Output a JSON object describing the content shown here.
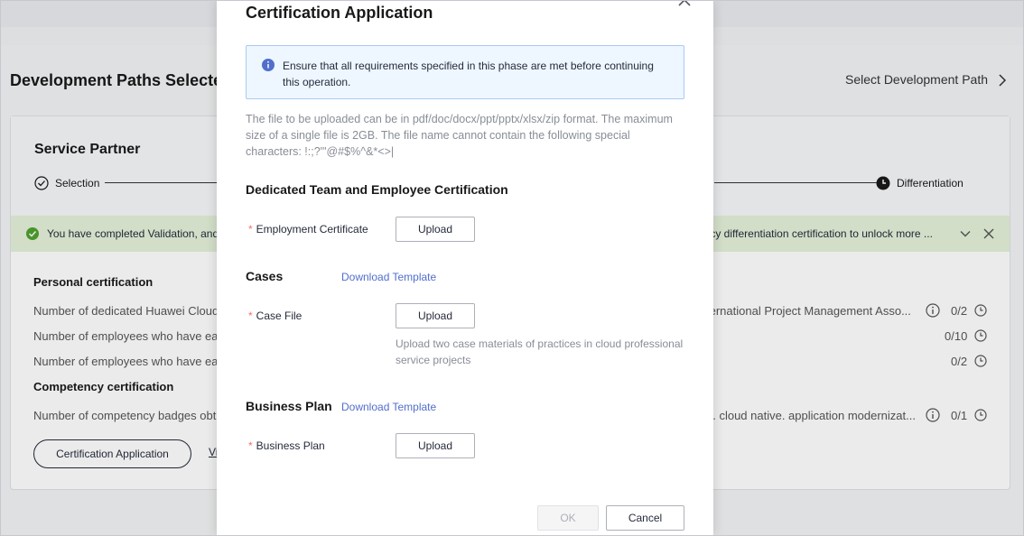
{
  "background": {
    "page_title": "Development Paths Selected",
    "select_path_link": "Select Development Path",
    "partner_title": "Service Partner",
    "steps": {
      "first": "Selection",
      "last": "Differentiation"
    },
    "success_banner": {
      "text_left": "You have completed Validation, and",
      "text_right": "ency differentiation certification to unlock more ..."
    },
    "personal_cert": {
      "title": "Personal certification",
      "rows": [
        {
          "text": "Number of dedicated Huawei Cloud",
          "right_text": "ternational Project Management Asso...",
          "count": "0/2"
        },
        {
          "text": "Number of employees who have ea",
          "right_text": "",
          "count": "0/10"
        },
        {
          "text": "Number of employees who have ea",
          "right_text": "",
          "count": "0/2"
        }
      ]
    },
    "competency_cert": {
      "title": "Competency certification",
      "rows": [
        {
          "text": "Number of competency badges obt",
          "right_text": "n. cloud native. application modernizat...",
          "count": "0/1"
        }
      ]
    },
    "cert_button": "Certification Application",
    "view_link": "Vi"
  },
  "modal": {
    "title": "Certification Application",
    "notice": "Ensure that all requirements specified in this phase are met before continuing this operation.",
    "file_note": "The file to be uploaded can be in pdf/doc/docx/ppt/pptx/xlsx/zip format. The maximum size of a single file is 2GB. The file name cannot contain the following special characters: !:;?'\"@#$%^&*<>|",
    "sections": {
      "team": {
        "title": "Dedicated Team and Employee Certification",
        "field_label": "Employment Certificate",
        "upload_label": "Upload"
      },
      "cases": {
        "title": "Cases",
        "download_label": "Download Template",
        "field_label": "Case File",
        "upload_label": "Upload",
        "hint": "Upload two case materials of practices in cloud professional service projects"
      },
      "plan": {
        "title": "Business Plan",
        "download_label": "Download Template",
        "field_label": "Business Plan",
        "upload_label": "Upload"
      }
    },
    "required_mark": "*",
    "ok_label": "OK",
    "cancel_label": "Cancel"
  },
  "colors": {
    "accent_link": "#526ecc",
    "success_bg": "#e4f1d9",
    "success_icon": "#50a12e",
    "notice_bg": "#eef6ff",
    "info_icon": "#526ecc",
    "required": "#f66f6a"
  },
  "icons": {
    "close": "close-icon",
    "info": "info-icon",
    "success": "check-circle-icon",
    "chevron": "chevron-right-icon"
  }
}
